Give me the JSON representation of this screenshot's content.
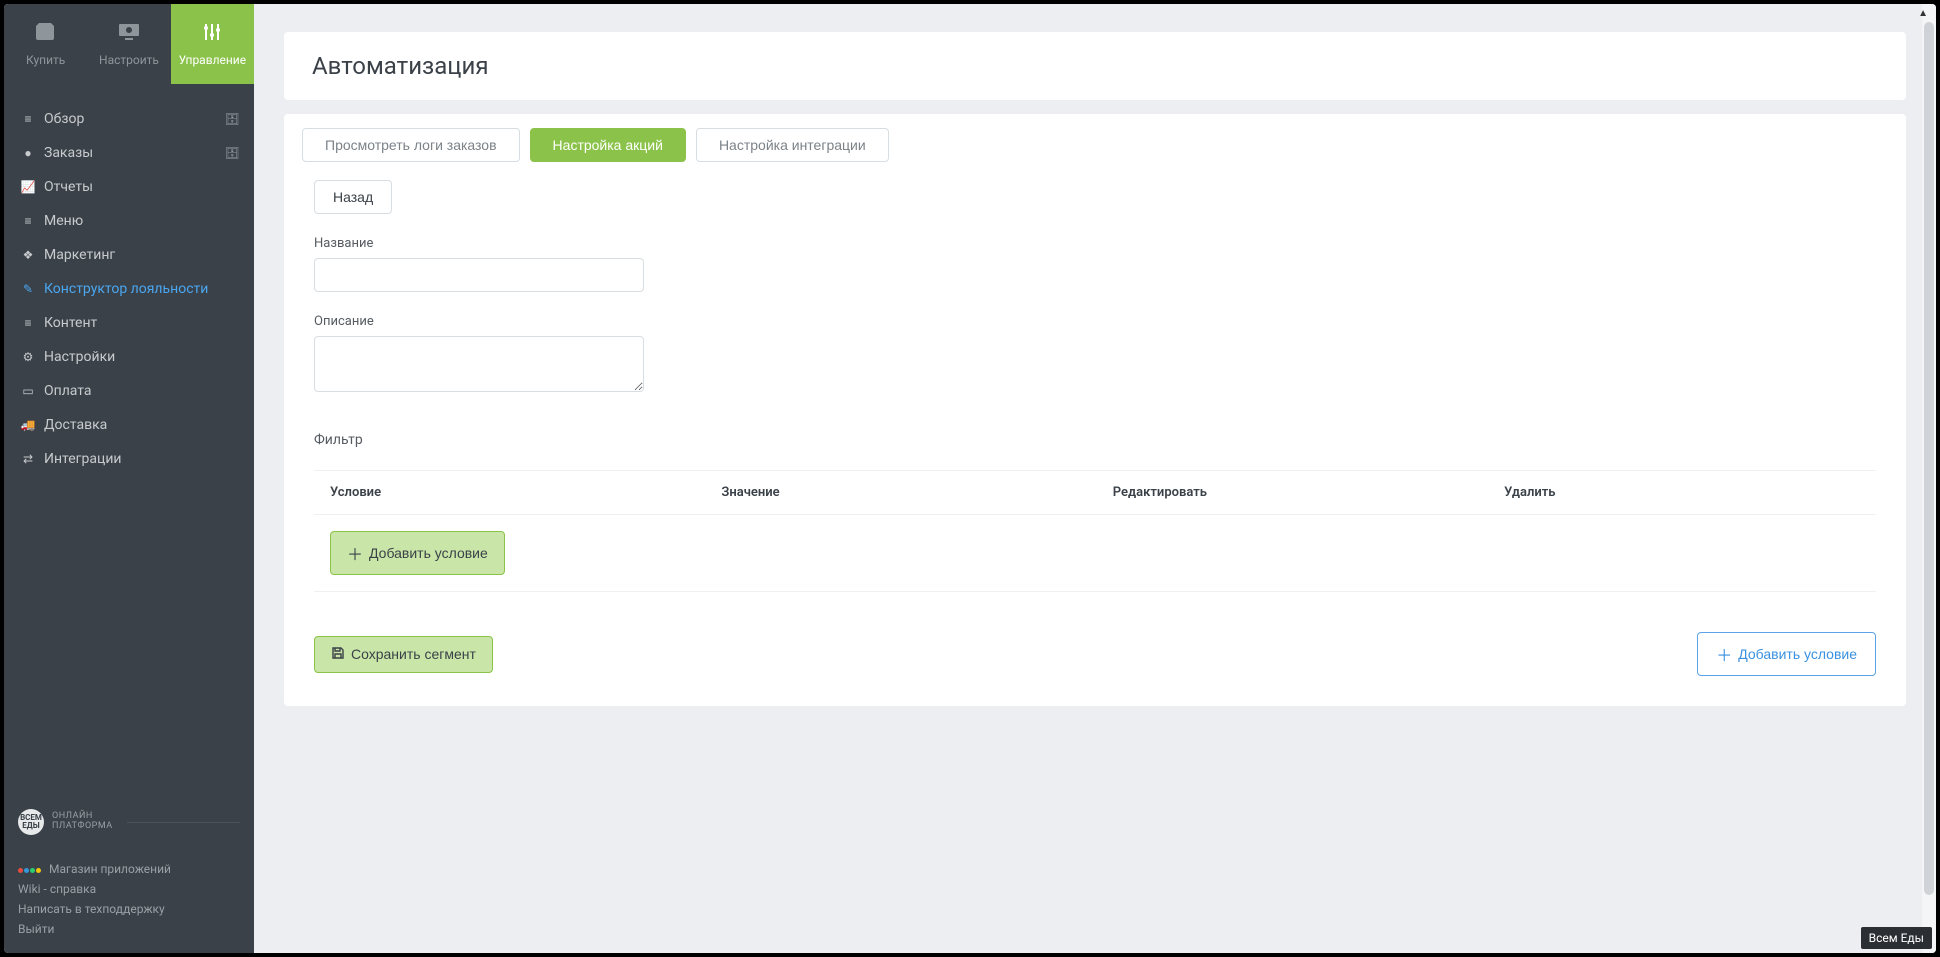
{
  "topnav": {
    "buy": "Купить",
    "setup": "Настроить",
    "manage": "Управление"
  },
  "sidenav": {
    "overview": "Обзор",
    "orders": "Заказы",
    "reports": "Отчеты",
    "menu": "Меню",
    "marketing": "Маркетинг",
    "loyalty": "Конструктор лояльности",
    "content": "Контент",
    "settings": "Настройки",
    "payment": "Оплата",
    "delivery": "Доставка",
    "integrations": "Интеграции"
  },
  "footer": {
    "logo_top": "ВСЕМ",
    "logo_bottom": "ЕДЫ",
    "platform_line1": "ОНЛАЙН",
    "platform_line2": "ПЛАТФОРМА",
    "app_store": "Магазин приложений",
    "wiki": "Wiki - справка",
    "support": "Написать в техподдержку",
    "logout": "Выйти"
  },
  "page": {
    "title": "Автоматизация"
  },
  "tabs": {
    "logs": "Просмотреть логи заказов",
    "actions": "Настройка акций",
    "integration": "Настройка интеграции"
  },
  "form": {
    "back": "Назад",
    "name_label": "Название",
    "name_value": "",
    "desc_label": "Описание",
    "desc_value": "",
    "filter_heading": "Фильтр"
  },
  "table": {
    "condition": "Условие",
    "value": "Значение",
    "edit": "Редактировать",
    "delete": "Удалить"
  },
  "buttons": {
    "add_condition": "Добавить условие",
    "save_segment": "Сохранить сегмент",
    "add_condition_blue": "Добавить условие"
  },
  "badge": "Всем Еды"
}
